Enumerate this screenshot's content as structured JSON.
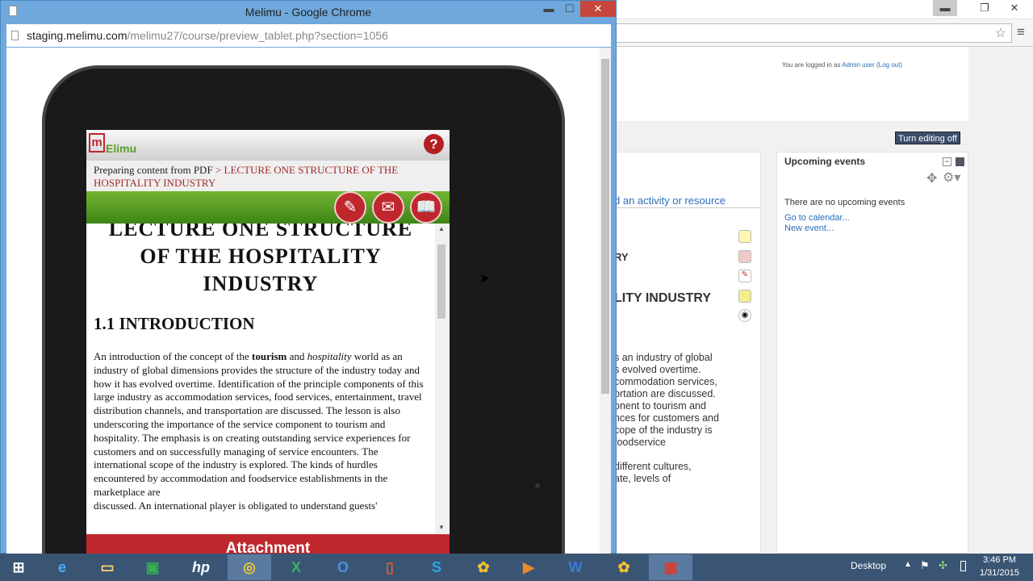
{
  "bg_window": {
    "logged_in_prefix": "You are logged in as",
    "user_link": "Admin user",
    "logout_link": "(Log out)",
    "editing_button": "Turn editing off",
    "add_activity": "d an activity or resource",
    "section_text_1": "RY",
    "section_title": "LITY INDUSTRY",
    "body_lines": [
      "s an industry of global",
      "s evolved overtime.",
      "commodation services,",
      "ortation are discussed.",
      "onent to tourism and",
      "nces for customers and",
      "cope of the industry is",
      "foodservice",
      "different cultures,",
      "ate, levels of"
    ],
    "upcoming": {
      "title": "Upcoming events",
      "empty": "There are no upcoming events",
      "calendar_link": "Go to calendar...",
      "new_event_link": "New event..."
    }
  },
  "fg_window": {
    "title": "Melimu - Google Chrome",
    "url_host": "staging.melimu.com",
    "url_path": "/melimu27/course/preview_tablet.php?section=1056"
  },
  "app": {
    "logo_text": "Elimu",
    "help_icon": "question-icon",
    "breadcrumb_prefix": "Preparing content from PDF",
    "breadcrumb_sep": ">",
    "breadcrumb_current": "LECTURE ONE STRUCTURE OF THE HOSPITALITY INDUSTRY",
    "buttons": [
      "edit-icon",
      "chat-icon",
      "book-icon"
    ],
    "heading": "LECTURE ONE STRUCTURE OF THE HOSPITALITY INDUSTRY",
    "subheading": "1.1 INTRODUCTION",
    "para_1_a": "An introduction of the concept of the ",
    "para_1_b": "tourism",
    "para_1_c": " and ",
    "para_1_d": "hospitality",
    "para_1_e": " world as an industry of global dimensions provides the structure of the industry today and how it has evolved overtime. Identification of the principle components of this large industry as accommodation services, food services, entertainment, travel distribution channels, and transportation are discussed. The lesson is also underscoring the importance of the service component to tourism and hospitality. The emphasis is on creating outstanding service experiences for customers and on successfully managing of service encounters. The international scope of the industry is explored. The kinds of hurdles encountered by accommodation and foodservice establishments in the marketplace are",
    "para_2": "discussed. An international player is obligated to understand guests'",
    "attachment": "Attachment"
  },
  "taskbar": {
    "desktop_label": "Desktop",
    "time": "3:46 PM",
    "date": "1/31/2015"
  },
  "colors": {
    "accent_red": "#c0272d",
    "green": "#5a9e26",
    "chrome_blue": "#6ea8dc",
    "taskbar": "#3a5574"
  }
}
